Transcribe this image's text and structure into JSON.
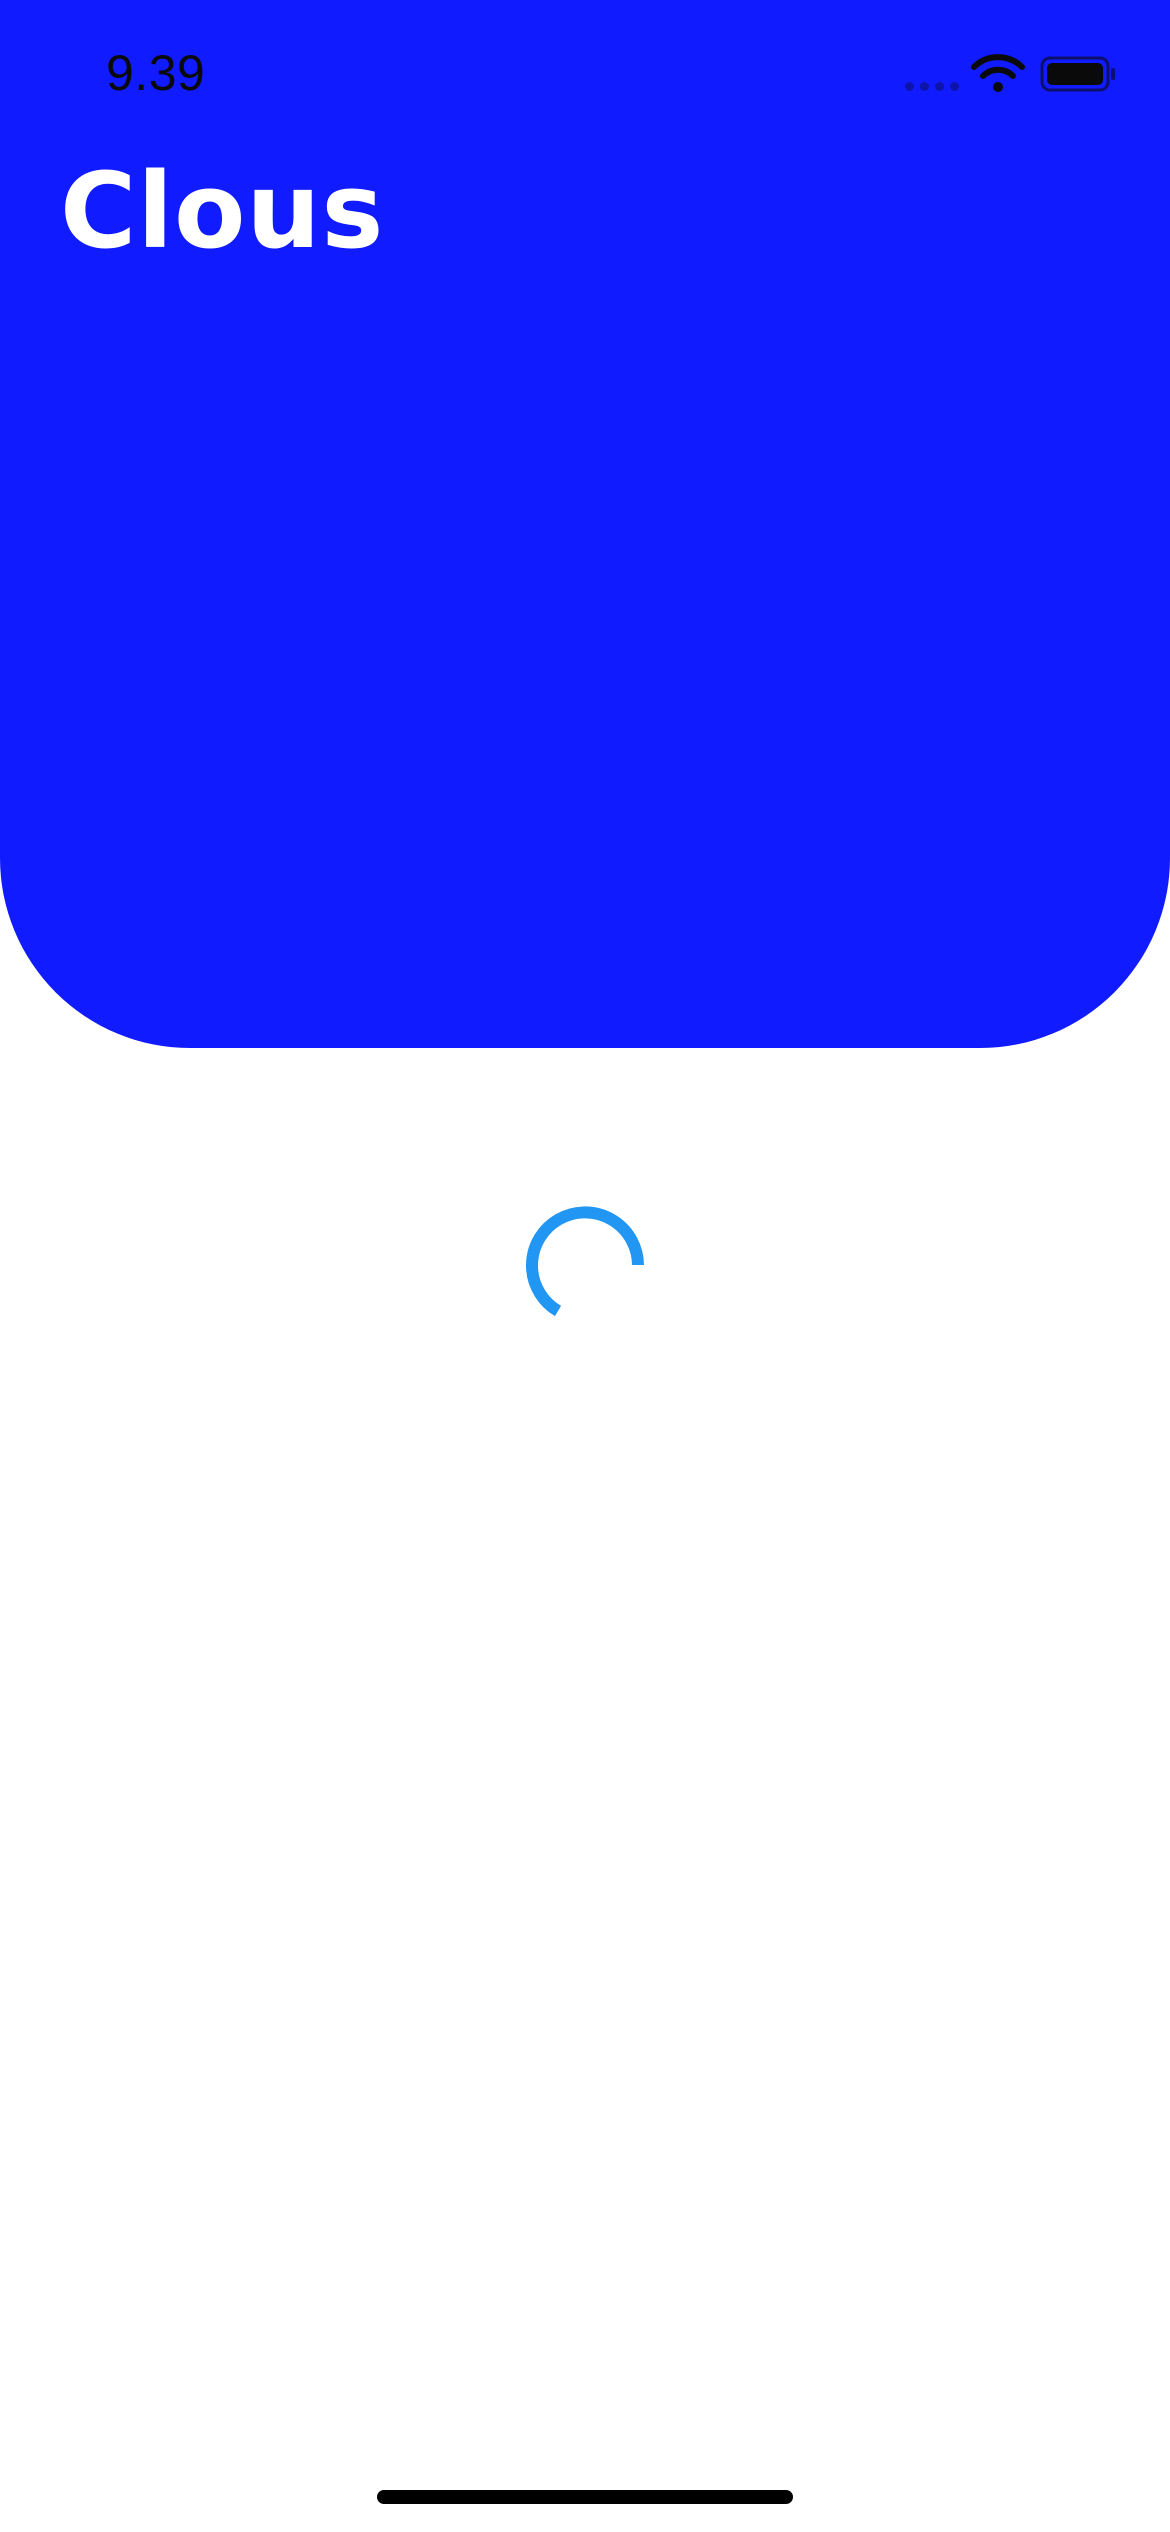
{
  "status_bar": {
    "time": "9.39",
    "icons": [
      "signal-icon",
      "wifi-icon",
      "battery-icon"
    ]
  },
  "header": {
    "title": "Clous"
  },
  "loading": {
    "icon": "loading-spinner-icon"
  },
  "colors": {
    "hero_background": "#111BFF",
    "title_text": "#FFFFFF",
    "spinner": "#2196F3",
    "page_background": "#FFFFFF"
  }
}
